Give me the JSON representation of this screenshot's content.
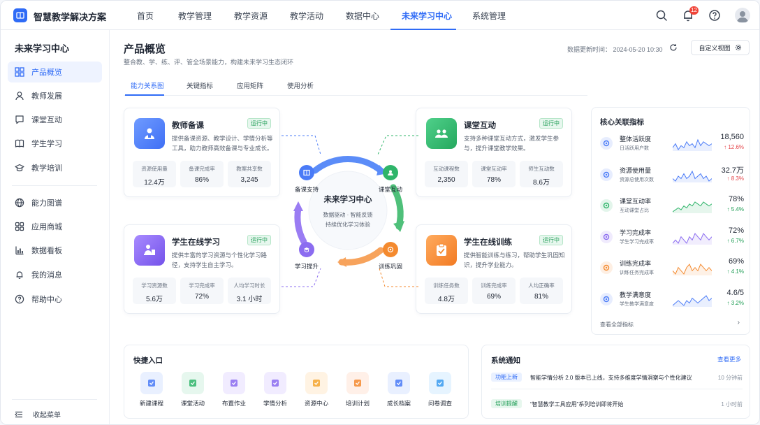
{
  "brand": "智慧教学解决方案",
  "nav": [
    "首页",
    "教学管理",
    "教学资源",
    "教学活动",
    "数据中心",
    "未来学习中心",
    "系统管理"
  ],
  "nav_active": 5,
  "notifications": "12",
  "sidebar": {
    "title": "未来学习中心",
    "items": [
      {
        "label": "产品概览",
        "icon": "grid-icon"
      },
      {
        "label": "教师发展",
        "icon": "user-icon"
      },
      {
        "label": "课堂互动",
        "icon": "chat-icon"
      },
      {
        "label": "学生学习",
        "icon": "book-icon"
      },
      {
        "label": "教学培训",
        "icon": "graduation-cap-icon"
      },
      {
        "label": "能力图谱",
        "icon": "globe-icon"
      },
      {
        "label": "应用商城",
        "icon": "apps-icon"
      },
      {
        "label": "数据看板",
        "icon": "bar-chart-icon"
      },
      {
        "label": "我的消息",
        "icon": "bell-icon"
      },
      {
        "label": "帮助中心",
        "icon": "help-icon"
      }
    ],
    "collapse": "收起菜单"
  },
  "header": {
    "title": "产品概览",
    "subtitle": "整合教、学、练、评、管全场景能力，构建未来学习生态闭环",
    "update_time": "数据更新时间： 2024-05-20 10:30",
    "custom_view": "自定义视图"
  },
  "tabs": [
    "能力关系图",
    "关键指标",
    "应用矩阵",
    "使用分析"
  ],
  "cards": [
    {
      "title": "教师备课",
      "status": "运行中",
      "desc": "提供备课资源、教学设计、学情分析等工具，助力教师高效备课与专业成长。",
      "color": "#4a7bf7",
      "stats": [
        {
          "label": "资源使用量",
          "value": "12.4万"
        },
        {
          "label": "备课完成率",
          "value": "86%"
        },
        {
          "label": "教案共享数",
          "value": "3,245"
        }
      ]
    },
    {
      "title": "课堂互动",
      "status": "运行中",
      "desc": "支持多种课堂互动方式，激发学生参与，提升课堂教学效果。",
      "color": "#2fb56a",
      "stats": [
        {
          "label": "互动课程数",
          "value": "2,350"
        },
        {
          "label": "课堂互动率",
          "value": "78%"
        },
        {
          "label": "师生互动数",
          "value": "8.6万"
        }
      ]
    },
    {
      "title": "学生在线学习",
      "status": "运行中",
      "desc": "提供丰富的学习资源与个性化学习路径，支持学生自主学习。",
      "color": "#8b6cf0",
      "stats": [
        {
          "label": "学习资源数",
          "value": "5.6万"
        },
        {
          "label": "学习完成率",
          "value": "72%"
        },
        {
          "label": "人均学习时长",
          "value": "3.1 小时"
        }
      ]
    },
    {
      "title": "学生在线训练",
      "status": "运行中",
      "desc": "提供智能训练与练习，帮助学生巩固知识，提升学业能力。",
      "color": "#f48a2f",
      "stats": [
        {
          "label": "训练任务数",
          "value": "4.8万"
        },
        {
          "label": "训练完成率",
          "value": "69%"
        },
        {
          "label": "人均正确率",
          "value": "81%"
        }
      ]
    }
  ],
  "ring": {
    "title": "未来学习中心",
    "sub1": "数据驱动 · 智能反馈",
    "sub2": "持续优化学习体验",
    "labels": [
      "备课支持",
      "课堂互动",
      "训练巩固",
      "学习提升"
    ]
  },
  "metrics": {
    "title": "核心关联指标",
    "rows": [
      {
        "name": "整体活跃度",
        "sub": "日活跃用户数",
        "value": "18,560",
        "change": "↑ 12.6%",
        "dir": "down",
        "color": "#4a7bf7",
        "spark": [
          5,
          7,
          4,
          6,
          5,
          8,
          6,
          7,
          5,
          9,
          6,
          8,
          7,
          6,
          7
        ]
      },
      {
        "name": "资源使用量",
        "sub": "资源总使用次数",
        "value": "32.7万",
        "change": "↑ 8.3%",
        "dir": "down",
        "color": "#4a7bf7",
        "spark": [
          6,
          5,
          7,
          6,
          8,
          6,
          7,
          9,
          6,
          7,
          8,
          6,
          7,
          5,
          6
        ]
      },
      {
        "name": "课堂互动率",
        "sub": "互动课堂占比",
        "value": "78%",
        "change": "↑ 5.4%",
        "dir": "up",
        "color": "#2fb56a",
        "spark": [
          4,
          5,
          6,
          5,
          7,
          6,
          8,
          7,
          9,
          8,
          7,
          9,
          8,
          7,
          8
        ]
      },
      {
        "name": "学习完成率",
        "sub": "学生学习完成率",
        "value": "72%",
        "change": "↑ 6.7%",
        "dir": "up",
        "color": "#8b6cf0",
        "spark": [
          5,
          6,
          5,
          7,
          6,
          5,
          7,
          6,
          8,
          7,
          6,
          8,
          7,
          6,
          7
        ]
      },
      {
        "name": "训练完成率",
        "sub": "训练任务完成率",
        "value": "69%",
        "change": "↑ 4.1%",
        "dir": "up",
        "color": "#f48a2f",
        "spark": [
          6,
          5,
          7,
          6,
          5,
          7,
          8,
          6,
          7,
          6,
          8,
          7,
          6,
          7,
          6
        ]
      },
      {
        "name": "教学满意度",
        "sub": "学生教学满意度",
        "value": "4.6/5",
        "change": "↑ 3.2%",
        "dir": "up",
        "color": "#4a7bf7",
        "spark": [
          5,
          6,
          7,
          6,
          5,
          7,
          6,
          8,
          7,
          6,
          7,
          8,
          9,
          7,
          8
        ]
      }
    ],
    "footer": "查看全部指标"
  },
  "quick": {
    "title": "快捷入口",
    "items": [
      {
        "label": "新建课程",
        "bg": "#e9f0ff",
        "fg": "#4a7bf7"
      },
      {
        "label": "课堂活动",
        "bg": "#e6f7ee",
        "fg": "#2fb56a"
      },
      {
        "label": "布置作业",
        "bg": "#f1ecff",
        "fg": "#8b6cf0"
      },
      {
        "label": "学情分析",
        "bg": "#f1ecff",
        "fg": "#8b6cf0"
      },
      {
        "label": "资源中心",
        "bg": "#fff3e3",
        "fg": "#f4a42f"
      },
      {
        "label": "培训计划",
        "bg": "#fff0e8",
        "fg": "#f48a2f"
      },
      {
        "label": "成长档案",
        "bg": "#e9f0ff",
        "fg": "#4a7bf7"
      },
      {
        "label": "问卷调查",
        "bg": "#e6f4ff",
        "fg": "#3a9bf0"
      }
    ]
  },
  "notice": {
    "title": "系统通知",
    "more": "查看更多",
    "rows": [
      {
        "tag": "功能上新",
        "text": "智能学情分析 2.0 版本已上线，支持多维度学情洞察与个性化建议",
        "time": "10 分钟前"
      },
      {
        "tag": "培训提醒",
        "text": "“智慧教学工具应用”系列培训即将开始",
        "time": "1 小时前"
      }
    ]
  }
}
